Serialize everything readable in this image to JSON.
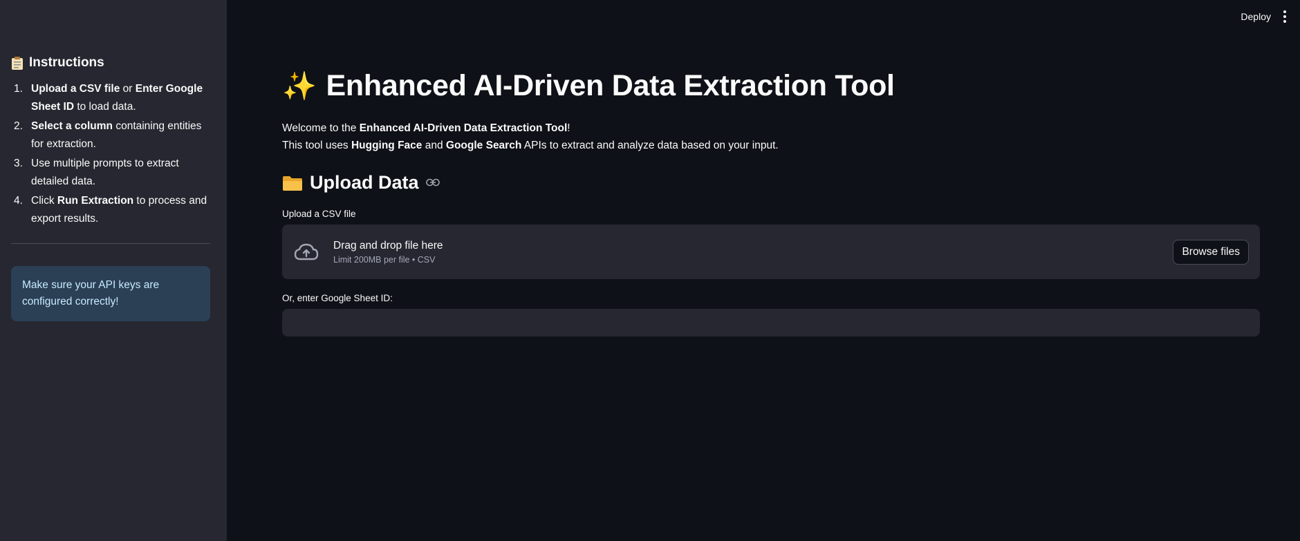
{
  "sidebar": {
    "heading": "Instructions",
    "steps": [
      {
        "num": "1.",
        "parts": [
          {
            "b": "Upload a CSV file"
          },
          {
            "t": " or "
          },
          {
            "b": "Enter Google Sheet ID"
          },
          {
            "t": " to load data."
          }
        ]
      },
      {
        "num": "2.",
        "parts": [
          {
            "b": "Select a column"
          },
          {
            "t": " containing entities for extraction."
          }
        ]
      },
      {
        "num": "3.",
        "parts": [
          {
            "t": "Use multiple prompts to extract detailed data."
          }
        ]
      },
      {
        "num": "4.",
        "parts": [
          {
            "t": "Click "
          },
          {
            "b": "Run Extraction"
          },
          {
            "t": " to process and export results."
          }
        ]
      }
    ],
    "info": "Make sure your API keys are configured correctly!"
  },
  "topbar": {
    "deploy_label": "Deploy"
  },
  "main": {
    "title": "Enhanced AI-Driven Data Extraction Tool",
    "intro_line1": [
      {
        "t": "Welcome to the "
      },
      {
        "b": "Enhanced AI-Driven Data Extraction Tool"
      },
      {
        "t": "!"
      }
    ],
    "intro_line2": [
      {
        "t": "This tool uses "
      },
      {
        "b": "Hugging Face"
      },
      {
        "t": " and "
      },
      {
        "b": "Google Search"
      },
      {
        "t": " APIs to extract and analyze data based on your input."
      }
    ],
    "upload_section_title": "Upload Data",
    "csv_label": "Upload a CSV file",
    "dropzone_title": "Drag and drop file here",
    "dropzone_sub": "Limit 200MB per file • CSV",
    "browse_label": "Browse files",
    "sheet_label": "Or, enter Google Sheet ID:",
    "sheet_value": ""
  },
  "icons": {
    "title": "sparkles-icon",
    "heading": "clipboard-icon",
    "section": "folder-icon",
    "dropzone": "cloud-upload-icon"
  },
  "colors": {
    "background": "#0e1117",
    "sidebar": "#262730",
    "info_bg": "#2b3f55",
    "info_text": "#c7ebff",
    "sparkle": "#f9c440"
  }
}
